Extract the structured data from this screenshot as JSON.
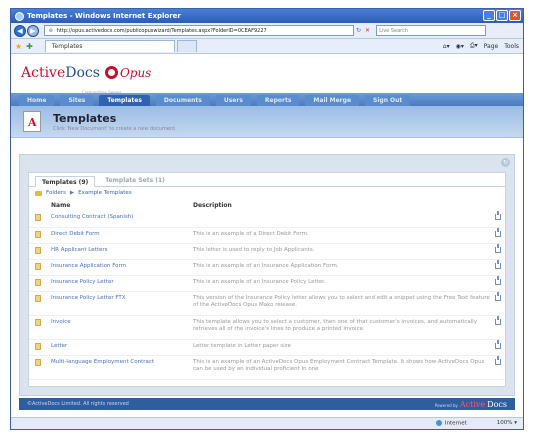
{
  "window": {
    "title": "Templates - Windows Internet Explorer"
  },
  "browser": {
    "url": "http://opus.activedocs.com/publicopuswizard/Templates.aspx?FolderID=0CEAF9227",
    "search_placeholder": "Live Search",
    "tab_title": "Templates",
    "toolbar": {
      "page": "Page",
      "tools": "Tools"
    }
  },
  "app": {
    "logo_active": "Active",
    "logo_docs": "Docs",
    "logo_opus": "Opus",
    "logo_sub": "Composition Server",
    "nav": [
      "Home",
      "Sites",
      "Templates",
      "Documents",
      "Users",
      "Reports",
      "Mail Merge",
      "Sign Out"
    ],
    "active_nav": "Templates",
    "page_title": "Templates",
    "page_subtitle": "Click 'New Document' to create a new document."
  },
  "panel": {
    "tabs": [
      "Templates (9)",
      "Template Sets (1)"
    ],
    "breadcrumb": {
      "root": "Folders",
      "current": "Example Templates"
    },
    "columns": {
      "name": "Name",
      "description": "Description"
    },
    "rows": [
      {
        "name": "Consulting Contract (Spanish)",
        "description": ""
      },
      {
        "name": "Direct Debit Form",
        "description": "This is an example of a Direct Debit Form."
      },
      {
        "name": "HR Applicant Letters",
        "description": "This letter is used to reply to Job Applicants."
      },
      {
        "name": "Insurance Application Form",
        "description": "This is an example of an Insurance Application Form."
      },
      {
        "name": "Insurance Policy Letter",
        "description": "This is an example of an Insurance Policy Letter."
      },
      {
        "name": "Insurance Policy Letter FTX",
        "description": "This version of the Insurance Policy letter allows you to select and edit a snippet using the Free Text feature of the ActiveDocs Opus Mako release."
      },
      {
        "name": "Invoice",
        "description": "This template allows you to select a customer, then one of that customer's invoices, and automatically retrieves all of the invoice's lines to produce a printed invoice."
      },
      {
        "name": "Letter",
        "description": "Letter template in Letter paper size"
      },
      {
        "name": "Multi-language Employment Contract",
        "description": "This is an example of an ActiveDocs Opus Employment Contract Template. It shows how ActiveDocs Opus can be used by an individual proficient in one"
      }
    ]
  },
  "footer": {
    "copyright": "©ActiveDocs Limited. All rights reserved",
    "powered_by": "Powered by",
    "brand_active": "Active",
    "brand_docs": "Docs"
  },
  "status": {
    "zone": "Internet",
    "zoom": "100%"
  }
}
